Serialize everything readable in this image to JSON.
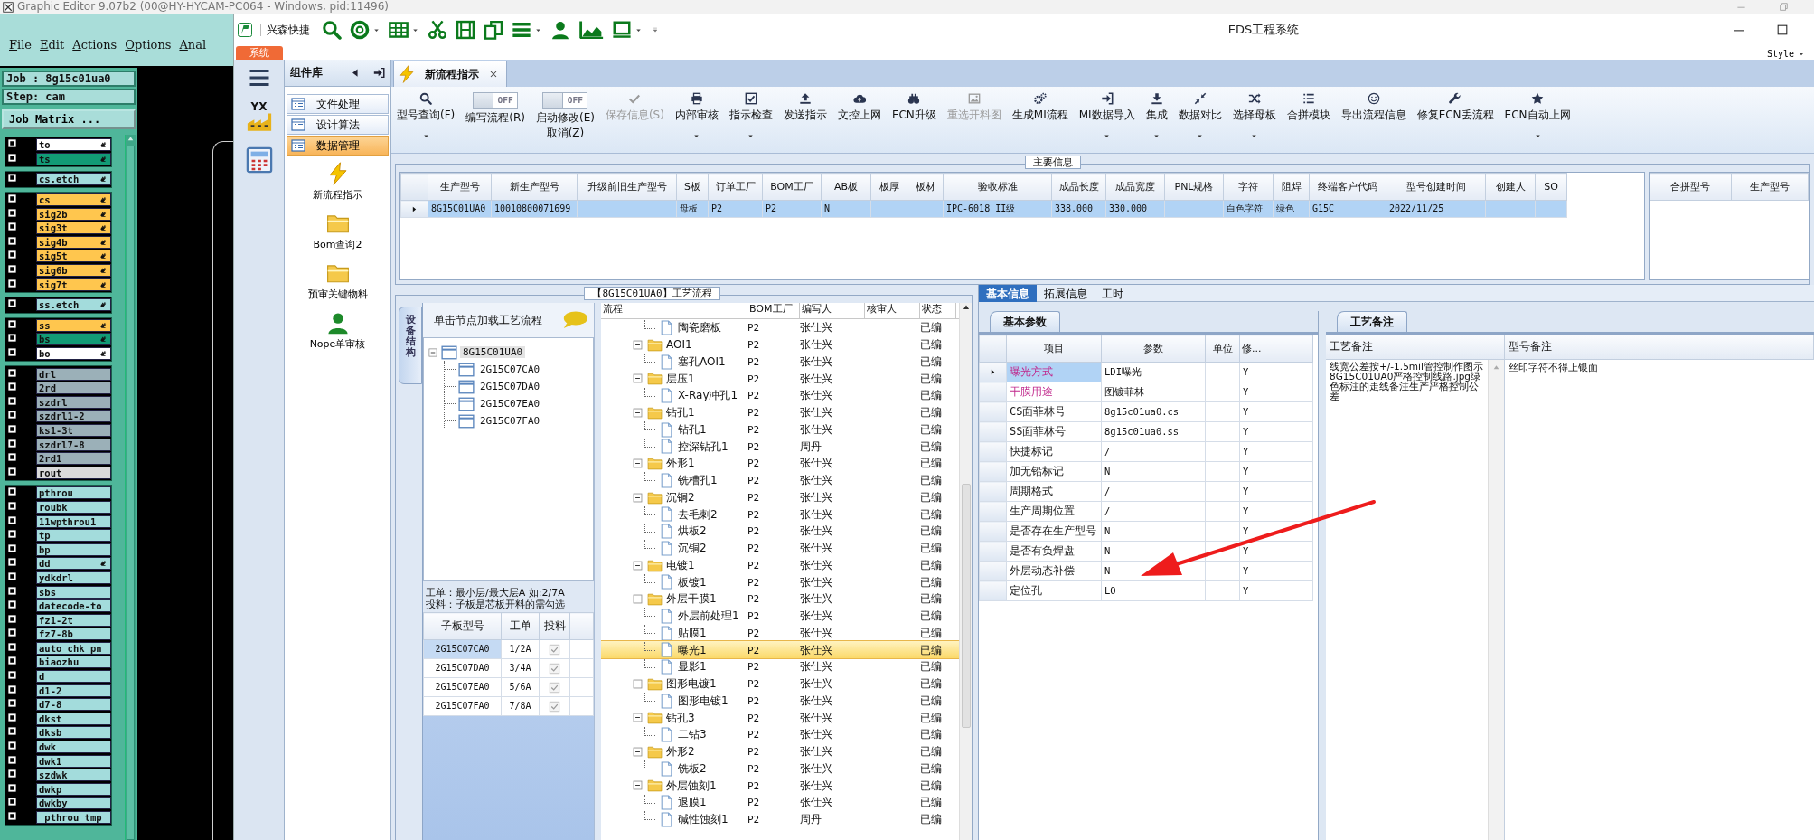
{
  "graphic_editor": {
    "title": "Graphic Editor 9.07b2 (00@HY-HYCAM-PC064 - Windows, pid:11496)",
    "menu": [
      "File",
      "Edit",
      "Actions",
      "Options",
      "Anal"
    ],
    "job": "Job : 8g15c01ua0",
    "step": "Step: cam",
    "matrix_button": "Job Matrix ...",
    "layer_groups": [
      {
        "layers": [
          {
            "name": "to",
            "color": "#ffffff",
            "marked": true,
            "checked": false
          },
          {
            "name": "ts",
            "color": "#129b76",
            "marked": true,
            "checked": false
          }
        ]
      },
      {
        "layers": [
          {
            "name": "cs.etch",
            "color": "#a3dcdc",
            "marked": true,
            "checked": false
          }
        ]
      },
      {
        "layers": [
          {
            "name": "cs",
            "color": "#ffc64e",
            "marked": true,
            "checked": false
          },
          {
            "name": "sig2b",
            "color": "#ffc64e",
            "marked": true,
            "checked": false
          },
          {
            "name": "sig3t",
            "color": "#ffc64e",
            "marked": true,
            "checked": false
          },
          {
            "name": "sig4b",
            "color": "#ffc64e",
            "marked": true,
            "checked": false
          },
          {
            "name": "sig5t",
            "color": "#ffc64e",
            "marked": true,
            "checked": false
          },
          {
            "name": "sig6b",
            "color": "#ffc64e",
            "marked": true,
            "checked": false
          },
          {
            "name": "sig7t",
            "color": "#ffc64e",
            "marked": true,
            "checked": false
          }
        ]
      },
      {
        "layers": [
          {
            "name": "ss.etch",
            "color": "#a3dcdc",
            "marked": true,
            "checked": false
          }
        ]
      },
      {
        "layers": [
          {
            "name": "ss",
            "color": "#ffc64e",
            "marked": true,
            "checked": false
          },
          {
            "name": "bs",
            "color": "#129b76",
            "marked": true,
            "checked": false
          },
          {
            "name": "bo",
            "color": "#ffffff",
            "marked": true,
            "checked": false
          }
        ]
      },
      {
        "layers": [
          {
            "name": "drl",
            "color": "#9bb0b8",
            "marked": false,
            "checked": false
          },
          {
            "name": "2rd",
            "color": "#9bb0b8",
            "marked": false,
            "checked": false
          },
          {
            "name": "szdrl",
            "color": "#9bb0b8",
            "marked": false,
            "checked": false
          },
          {
            "name": "szdrl1-2",
            "color": "#9bb0b8",
            "marked": false,
            "checked": false
          },
          {
            "name": "ks1-3t",
            "color": "#9bb0b8",
            "marked": false,
            "checked": false
          },
          {
            "name": "szdrl7-8",
            "color": "#9bb0b8",
            "marked": false,
            "checked": false
          },
          {
            "name": "2rd1",
            "color": "#9bb0b8",
            "marked": false,
            "checked": false
          },
          {
            "name": "rout",
            "color": "#dadada",
            "marked": false,
            "checked": false
          }
        ]
      },
      {
        "layers": [
          {
            "name": "pthrou",
            "color": "#a3dcdc",
            "marked": false,
            "checked": false
          },
          {
            "name": "roubk",
            "color": "#a3dcdc",
            "marked": false,
            "checked": false
          },
          {
            "name": "11wpthrou1",
            "color": "#a3dcdc",
            "marked": false,
            "checked": false
          },
          {
            "name": "tp",
            "color": "#a3dcdc",
            "marked": false,
            "checked": false
          },
          {
            "name": "bp",
            "color": "#a3dcdc",
            "marked": false,
            "checked": false
          },
          {
            "name": "dd",
            "color": "#a3dcdc",
            "marked": true,
            "checked": false
          },
          {
            "name": "ydkdrl",
            "color": "#a3dcdc",
            "marked": false,
            "checked": false
          },
          {
            "name": "sbs",
            "color": "#a3dcdc",
            "marked": false,
            "checked": false
          },
          {
            "name": "datecode-to",
            "color": "#a3dcdc",
            "marked": false,
            "checked": false
          },
          {
            "name": "fz1-2t",
            "color": "#a3dcdc",
            "marked": false,
            "checked": false
          },
          {
            "name": "fz7-8b",
            "color": "#a3dcdc",
            "marked": false,
            "checked": false
          },
          {
            "name": "auto_chk_pn",
            "color": "#a3dcdc",
            "marked": false,
            "checked": false
          },
          {
            "name": "biaozhu",
            "color": "#a3dcdc",
            "marked": false,
            "checked": false
          },
          {
            "name": "d",
            "color": "#a3dcdc",
            "marked": false,
            "checked": false
          },
          {
            "name": "d1-2",
            "color": "#a3dcdc",
            "marked": false,
            "checked": false
          },
          {
            "name": "d7-8",
            "color": "#a3dcdc",
            "marked": false,
            "checked": false
          },
          {
            "name": "dkst",
            "color": "#a3dcdc",
            "marked": false,
            "checked": false
          },
          {
            "name": "dksb",
            "color": "#a3dcdc",
            "marked": false,
            "checked": false
          },
          {
            "name": "dwk",
            "color": "#a3dcdc",
            "marked": false,
            "checked": false
          },
          {
            "name": "dwk1",
            "color": "#a3dcdc",
            "marked": false,
            "checked": false
          },
          {
            "name": "szdwk",
            "color": "#a3dcdc",
            "marked": false,
            "checked": false
          },
          {
            "name": "dwkp",
            "color": "#a3dcdc",
            "marked": false,
            "checked": false
          },
          {
            "name": "dwkby",
            "color": "#a3dcdc",
            "marked": false,
            "checked": false
          },
          {
            "name": "_pthrou_tmp",
            "color": "#a3dcdc",
            "marked": false,
            "checked": false
          }
        ]
      }
    ]
  },
  "eds": {
    "title": "EDS工程系统",
    "app_name": "兴森快捷",
    "quick_tools": [
      {
        "dropdown": false
      },
      {
        "dropdown": true
      },
      {
        "dropdown": true
      },
      {
        "dropdown": false
      },
      {
        "dropdown": false
      },
      {
        "dropdown": false
      },
      {
        "dropdown": true
      },
      {
        "dropdown": false
      },
      {
        "dropdown": false
      },
      {
        "dropdown": true
      }
    ],
    "system_tab": "系统",
    "style_menu": "Style",
    "nav_logo_text": "YX",
    "component_panel": {
      "title": "组件库",
      "categories": [
        {
          "label": "文件处理",
          "selected": false
        },
        {
          "label": "设计算法",
          "selected": false
        },
        {
          "label": "数据管理",
          "selected": true
        }
      ],
      "modules": [
        "新流程指示",
        "Bom查询2",
        "预审关键物料",
        "Nope单审核"
      ]
    },
    "doc_tab": "新流程指示",
    "toolbar": [
      {
        "kind": "button",
        "label": "型号查询(F)",
        "dropdown": true,
        "disabled": false
      },
      {
        "kind": "toggle",
        "label": "编写流程(R)",
        "switch_text": "OFF",
        "on": false
      },
      {
        "kind": "toggle",
        "label": "启动修改(E)",
        "sublabel": "取消(Z)",
        "switch_text": "OFF",
        "on": false
      },
      {
        "kind": "button",
        "label": "保存信息(S)",
        "dropdown": false,
        "disabled": true
      },
      {
        "kind": "button",
        "label": "内部审核",
        "dropdown": true,
        "disabled": false
      },
      {
        "kind": "button",
        "label": "指示检查",
        "dropdown": true,
        "disabled": false
      },
      {
        "kind": "button",
        "label": "发送指示",
        "dropdown": false,
        "disabled": false
      },
      {
        "kind": "button",
        "label": "文控上网",
        "dropdown": false,
        "disabled": false
      },
      {
        "kind": "button",
        "label": "ECN升级",
        "dropdown": false,
        "disabled": false
      },
      {
        "kind": "button",
        "label": "重选开料图",
        "dropdown": false,
        "disabled": true
      },
      {
        "kind": "button",
        "label": "生成MI流程",
        "dropdown": false,
        "disabled": false
      },
      {
        "kind": "button",
        "label": "MI数据导入",
        "dropdown": true,
        "disabled": false
      },
      {
        "kind": "button",
        "label": "集成",
        "dropdown": true,
        "disabled": false
      },
      {
        "kind": "button",
        "label": "数据对比",
        "dropdown": true,
        "disabled": false
      },
      {
        "kind": "button",
        "label": "选择母板",
        "dropdown": true,
        "disabled": false
      },
      {
        "kind": "button",
        "label": "合拼模块",
        "dropdown": false,
        "disabled": false
      },
      {
        "kind": "button",
        "label": "导出流程信息",
        "dropdown": false,
        "disabled": false
      },
      {
        "kind": "button",
        "label": "修复ECN丢流程",
        "dropdown": false,
        "disabled": false
      },
      {
        "kind": "button",
        "label": "ECN自动上网",
        "dropdown": true,
        "disabled": false
      }
    ],
    "main_info": {
      "title": "主要信息",
      "columns": [
        "生产型号",
        "新生产型号",
        "升级前旧生产型号",
        "S板",
        "订单工厂",
        "BOM工厂",
        "AB板",
        "板厚",
        "板材",
        "验收标准",
        "成品长度",
        "成品宽度",
        "PNL规格",
        "字符",
        "阻焊",
        "终端客户代码",
        "型号创建时间",
        "创建人",
        "SO"
      ],
      "rows": [
        {
          "selected": true,
          "cells": [
            "8G15C01UA0",
            "10010800071699",
            null,
            "母板",
            "P2",
            "P2",
            "N",
            null,
            null,
            "IPC-6018 II级",
            "338.000",
            "330.000",
            null,
            "白色字符",
            "绿色",
            "G15C",
            "2022/11/25",
            null,
            null
          ]
        }
      ]
    },
    "merge_grid": {
      "columns": [
        "合拼型号",
        "生产型号"
      ]
    },
    "flow_panel": {
      "title": "【8G15C01UA0】工艺流程",
      "side_tab": "设备结构",
      "tree_hint": "单击节点加载工艺流程",
      "tree": {
        "label": "8G15C01UA0",
        "expanded": true,
        "selected": true,
        "children": [
          {
            "label": "2G15C07CA0",
            "selected": false
          },
          {
            "label": "2G15C07DA0",
            "selected": false
          },
          {
            "label": "2G15C07EA0",
            "selected": false
          },
          {
            "label": "2G15C07FA0",
            "selected": false
          }
        ]
      },
      "notes": [
        "工单：最小层/最大层A 如:2/7A",
        "投料：子板是芯板开料的需勾选"
      ],
      "subboards": {
        "columns": [
          "子板型号",
          "工单",
          "投料"
        ],
        "rows": [
          {
            "model": "2G15C07CA0",
            "order": "1/2A",
            "checked": true,
            "selected": true
          },
          {
            "model": "2G15C07DA0",
            "order": "3/4A",
            "checked": true,
            "selected": false
          },
          {
            "model": "2G15C07EA0",
            "order": "5/6A",
            "checked": true,
            "selected": false
          },
          {
            "model": "2G15C07FA0",
            "order": "7/8A",
            "checked": true,
            "selected": false
          }
        ]
      },
      "flow_grid": {
        "columns": [
          "流程",
          "BOM工厂",
          "编写人",
          "核审人",
          "状态"
        ],
        "rows": [
          {
            "kind": "step",
            "name": "陶瓷磨板",
            "bom": "P2",
            "writer": "张仕兴",
            "status": "已编",
            "selected": false
          },
          {
            "kind": "group",
            "name": "AOI1",
            "bom": "P2",
            "writer": "张仕兴",
            "status": "已编",
            "expanded": true,
            "selected": false,
            "children": [
              {
                "kind": "step",
                "name": "塞孔AOI1",
                "bom": "P2",
                "writer": "张仕兴",
                "status": "已编",
                "selected": false
              }
            ]
          },
          {
            "kind": "group",
            "name": "层压1",
            "bom": "P2",
            "writer": "张仕兴",
            "status": "已编",
            "expanded": true,
            "selected": false,
            "children": [
              {
                "kind": "step",
                "name": "X-Ray冲孔1",
                "bom": "P2",
                "writer": "张仕兴",
                "status": "已编",
                "selected": false
              }
            ]
          },
          {
            "kind": "group",
            "name": "钻孔1",
            "bom": "P2",
            "writer": "张仕兴",
            "status": "已编",
            "expanded": true,
            "selected": false,
            "children": [
              {
                "kind": "step",
                "name": "钻孔1",
                "bom": "P2",
                "writer": "张仕兴",
                "status": "已编",
                "selected": false
              },
              {
                "kind": "step",
                "name": "控深钻孔1",
                "bom": "P2",
                "writer": "周丹",
                "status": "已编",
                "selected": false
              }
            ]
          },
          {
            "kind": "group",
            "name": "外形1",
            "bom": "P2",
            "writer": "张仕兴",
            "status": "已编",
            "expanded": true,
            "selected": false,
            "children": [
              {
                "kind": "step",
                "name": "铣槽孔1",
                "bom": "P2",
                "writer": "张仕兴",
                "status": "已编",
                "selected": false
              }
            ]
          },
          {
            "kind": "group",
            "name": "沉铜2",
            "bom": "P2",
            "writer": "张仕兴",
            "status": "已编",
            "expanded": true,
            "selected": false,
            "children": [
              {
                "kind": "step",
                "name": "去毛刺2",
                "bom": "P2",
                "writer": "张仕兴",
                "status": "已编",
                "selected": false
              },
              {
                "kind": "step",
                "name": "烘板2",
                "bom": "P2",
                "writer": "张仕兴",
                "status": "已编",
                "selected": false
              },
              {
                "kind": "step",
                "name": "沉铜2",
                "bom": "P2",
                "writer": "张仕兴",
                "status": "已编",
                "selected": false
              }
            ]
          },
          {
            "kind": "group",
            "name": "电镀1",
            "bom": "P2",
            "writer": "张仕兴",
            "status": "已编",
            "expanded": true,
            "selected": false,
            "children": [
              {
                "kind": "step",
                "name": "板镀1",
                "bom": "P2",
                "writer": "张仕兴",
                "status": "已编",
                "selected": false
              }
            ]
          },
          {
            "kind": "group",
            "name": "外层干膜1",
            "bom": "P2",
            "writer": "张仕兴",
            "status": "已编",
            "expanded": true,
            "selected": false,
            "children": [
              {
                "kind": "step",
                "name": "外层前处理1",
                "bom": "P2",
                "writer": "张仕兴",
                "status": "已编",
                "selected": false
              },
              {
                "kind": "step",
                "name": "贴膜1",
                "bom": "P2",
                "writer": "张仕兴",
                "status": "已编",
                "selected": false
              },
              {
                "kind": "step",
                "name": "曝光1",
                "bom": "P2",
                "writer": "张仕兴",
                "status": "已编",
                "selected": true
              },
              {
                "kind": "step",
                "name": "显影1",
                "bom": "P2",
                "writer": "张仕兴",
                "status": "已编",
                "selected": false
              }
            ]
          },
          {
            "kind": "group",
            "name": "图形电镀1",
            "bom": "P2",
            "writer": "张仕兴",
            "status": "已编",
            "expanded": true,
            "selected": false,
            "children": [
              {
                "kind": "step",
                "name": "图形电镀1",
                "bom": "P2",
                "writer": "张仕兴",
                "status": "已编",
                "selected": false
              }
            ]
          },
          {
            "kind": "group",
            "name": "钻孔3",
            "bom": "P2",
            "writer": "张仕兴",
            "status": "已编",
            "expanded": true,
            "selected": false,
            "children": [
              {
                "kind": "step",
                "name": "二钻3",
                "bom": "P2",
                "writer": "张仕兴",
                "status": "已编",
                "selected": false
              }
            ]
          },
          {
            "kind": "group",
            "name": "外形2",
            "bom": "P2",
            "writer": "张仕兴",
            "status": "已编",
            "expanded": true,
            "selected": false,
            "children": [
              {
                "kind": "step",
                "name": "铣板2",
                "bom": "P2",
                "writer": "张仕兴",
                "status": "已编",
                "selected": false
              }
            ]
          },
          {
            "kind": "group",
            "name": "外层蚀刻1",
            "bom": "P2",
            "writer": "张仕兴",
            "status": "已编",
            "expanded": true,
            "selected": false,
            "children": [
              {
                "kind": "step",
                "name": "退膜1",
                "bom": "P2",
                "writer": "张仕兴",
                "status": "已编",
                "selected": false
              },
              {
                "kind": "step",
                "name": "碱性蚀刻1",
                "bom": "P2",
                "writer": "周丹",
                "status": "已编",
                "selected": false
              }
            ]
          }
        ]
      }
    },
    "detail_tabs": [
      {
        "label": "基本信息",
        "selected": true
      },
      {
        "label": "拓展信息",
        "selected": false
      },
      {
        "label": "工时",
        "selected": false
      }
    ],
    "params": {
      "tab": "基本参数",
      "columns": [
        "项目",
        "参数",
        "单位",
        "修..."
      ],
      "rows": [
        {
          "item": "曝光方式",
          "value": "LDI曝光",
          "modified": "Y",
          "flagged": true,
          "selected": true
        },
        {
          "item": "干膜用途",
          "value": "图镀菲林",
          "modified": "Y",
          "flagged": true,
          "selected": false
        },
        {
          "item": "CS面菲林号",
          "value": "8g15c01ua0.cs",
          "modified": "Y",
          "flagged": false,
          "selected": false
        },
        {
          "item": "SS面菲林号",
          "value": "8g15c01ua0.ss",
          "modified": "Y",
          "flagged": false,
          "selected": false
        },
        {
          "item": "快捷标记",
          "value": "/",
          "modified": "Y",
          "flagged": false,
          "selected": false
        },
        {
          "item": "加无铅标记",
          "value": "N",
          "modified": "Y",
          "flagged": false,
          "selected": false
        },
        {
          "item": "周期格式",
          "value": "/",
          "modified": "Y",
          "flagged": false,
          "selected": false
        },
        {
          "item": "生产周期位置",
          "value": "/",
          "modified": "Y",
          "flagged": false,
          "selected": false
        },
        {
          "item": "是否存在生产型号",
          "value": "N",
          "modified": "Y",
          "flagged": false,
          "selected": false
        },
        {
          "item": "是否有负焊盘",
          "value": "N",
          "modified": "Y",
          "flagged": false,
          "selected": false
        },
        {
          "item": "外层动态补偿",
          "value": "N",
          "modified": "Y",
          "flagged": false,
          "selected": false
        },
        {
          "item": "定位孔",
          "value": "LO",
          "modified": "Y",
          "flagged": false,
          "selected": false
        }
      ]
    },
    "remarks": {
      "tab": "工艺备注",
      "columns": [
        "工艺备注",
        "型号备注"
      ],
      "process_note": "线宽公差按+/-1.5mil管控制作图示8G15C01UA0严格控制线路.jpg绿色标注的走线备注生产严格控制公差",
      "model_note": "丝印字符不得上银面"
    }
  }
}
